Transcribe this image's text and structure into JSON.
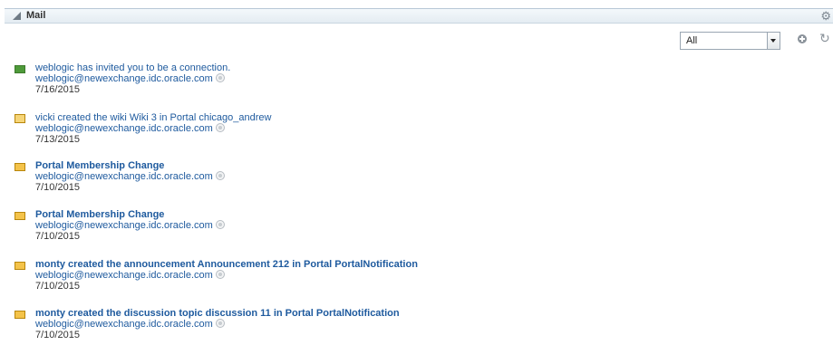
{
  "panel": {
    "title": "Mail",
    "collapse_icon": "collapse-triangle-icon",
    "settings_icon": "gear-icon"
  },
  "toolbar": {
    "filter_value": "All",
    "add_icon": "plus-circle-icon",
    "refresh_icon": "refresh-icon"
  },
  "messages": [
    {
      "icon": "invite-icon",
      "subject": "weblogic has invited you to be a connection.",
      "bold": false,
      "sender": "weblogic@newexchange.idc.oracle.com",
      "date": "7/16/2015"
    },
    {
      "icon": "envelope-open-icon",
      "subject": "vicki created the wiki Wiki 3 in Portal chicago_andrew",
      "bold": false,
      "sender": "weblogic@newexchange.idc.oracle.com",
      "date": "7/13/2015"
    },
    {
      "icon": "envelope-icon",
      "subject": "Portal Membership Change",
      "bold": true,
      "sender": "weblogic@newexchange.idc.oracle.com",
      "date": "7/10/2015"
    },
    {
      "icon": "envelope-icon",
      "subject": "Portal Membership Change",
      "bold": true,
      "sender": "weblogic@newexchange.idc.oracle.com",
      "date": "7/10/2015"
    },
    {
      "icon": "envelope-icon",
      "subject": "monty created the announcement Announcement 212 in Portal PortalNotification",
      "bold": true,
      "sender": "weblogic@newexchange.idc.oracle.com",
      "date": "7/10/2015"
    },
    {
      "icon": "envelope-icon",
      "subject": "monty created the discussion topic discussion 11 in Portal PortalNotification",
      "bold": true,
      "sender": "weblogic@newexchange.idc.oracle.com",
      "date": "7/10/2015"
    }
  ]
}
